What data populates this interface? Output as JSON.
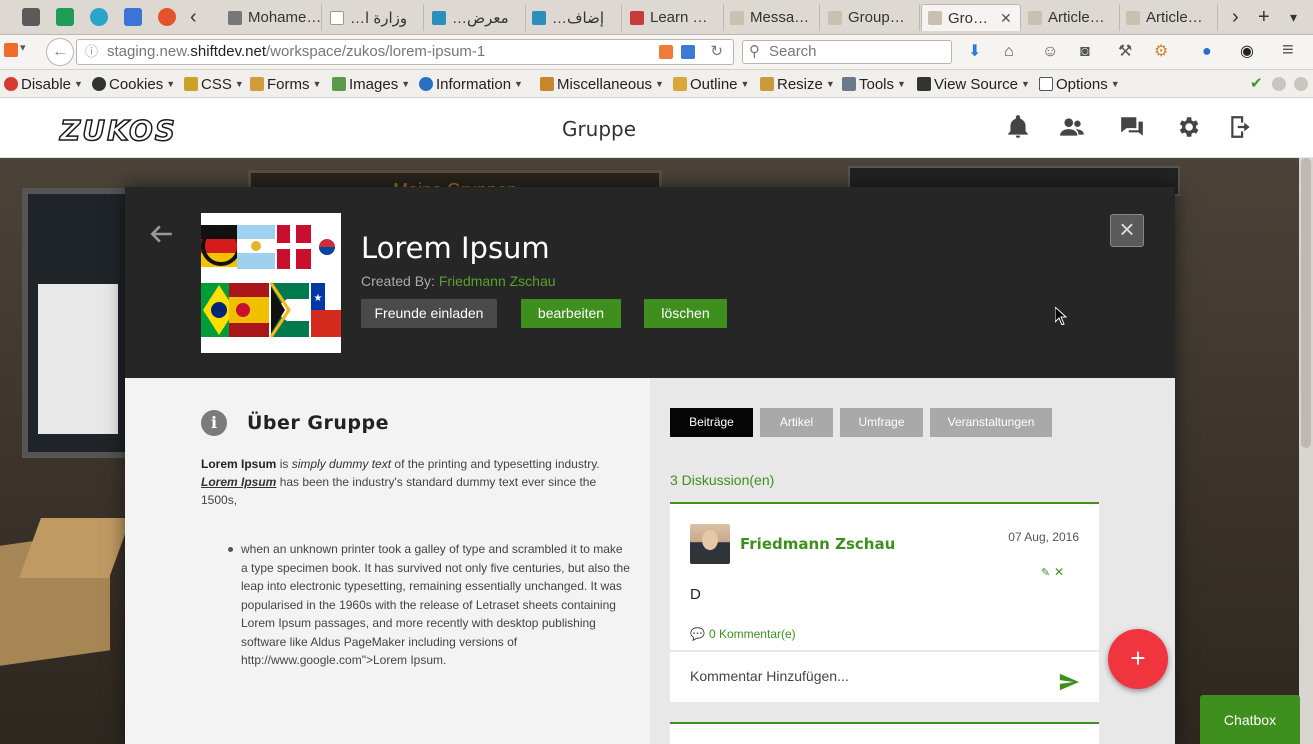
{
  "browser": {
    "tabs": [
      {
        "label": "Mohame…"
      },
      {
        "label": "…وزارة ا"
      },
      {
        "label": "…معرض"
      },
      {
        "label": "…إضاف"
      },
      {
        "label": "Learn …"
      },
      {
        "label": "Messa…"
      },
      {
        "label": "Group…"
      },
      {
        "label": "Gro…",
        "active": true
      },
      {
        "label": "Article…"
      },
      {
        "label": "Article…"
      }
    ],
    "url_prefix": "staging.new.",
    "url_domain": "shiftdev.net",
    "url_path": "/workspace/zukos/lorem-ipsum-1",
    "search_placeholder": "Search"
  },
  "webdev_toolbar": {
    "items": [
      {
        "label": "Disable"
      },
      {
        "label": "Cookies"
      },
      {
        "label": "CSS"
      },
      {
        "label": "Forms"
      },
      {
        "label": "Images"
      },
      {
        "label": "Information"
      },
      {
        "label": "Miscellaneous"
      },
      {
        "label": "Outline"
      },
      {
        "label": "Resize"
      },
      {
        "label": "Tools"
      },
      {
        "label": "View Source"
      },
      {
        "label": "Options"
      }
    ]
  },
  "site": {
    "logo_text": "ZUKOS",
    "page_title": "Gruppe"
  },
  "background": {
    "board_text": "Meine Gruppen"
  },
  "group": {
    "name": "Lorem Ipsum",
    "created_by_label": "Created By:",
    "creator": "Friedmann Zschau",
    "invite_label": "Freunde einladen",
    "edit_label": "bearbeiten",
    "delete_label": "löschen",
    "close_symbol": "×"
  },
  "about": {
    "title": "Über Gruppe",
    "icon": "info-icon",
    "line1_bold": "Lorem Ipsum",
    "line1_is": " is ",
    "line1_italic": "simply dummy text",
    "line1_rest": " of the printing and typesetting industry.",
    "line2_underlined": "Lorem Ipsum",
    "line2_rest": " has been the industry's standard dummy text ever since the 1500s,",
    "bullet": "when an unknown printer took a galley of type and scrambled it to make a type specimen book. It has survived not only five centuries, but also the leap into electronic typesetting, remaining essentially unchanged. It was popularised in the 1960s with the release of Letraset sheets containing Lorem Ipsum passages, and more recently with desktop publishing software like Aldus PageMaker including versions of http://www.google.com\">Lorem Ipsum."
  },
  "tabs": [
    {
      "label": "Beiträge",
      "active": true
    },
    {
      "label": "Artikel",
      "active": false
    },
    {
      "label": "Umfrage",
      "active": false
    },
    {
      "label": "Veranstaltungen",
      "active": false
    }
  ],
  "discussions": {
    "count_label": "3 Diskussion(en)",
    "post": {
      "author": "Friedmann Zschau",
      "date": "07 Aug, 2016",
      "body": "D",
      "comments_label": "0 Kommentar(e)"
    },
    "comment_placeholder": "Kommentar Hinzufügen..."
  },
  "fab_symbol": "+",
  "chatbox_label": "Chatbox",
  "colors": {
    "accent_green": "#3f8f1f",
    "fab_red": "#f0353f",
    "header_dark": "#262626"
  }
}
